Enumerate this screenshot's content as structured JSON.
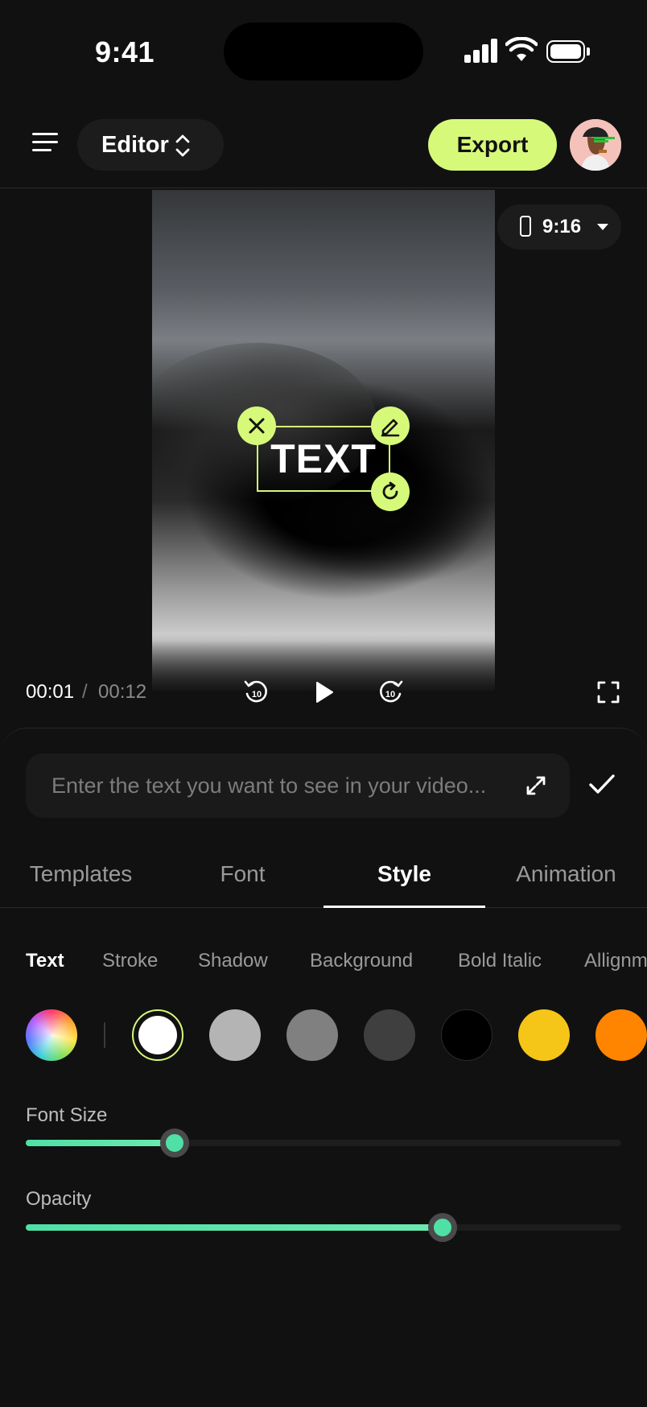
{
  "status_bar": {
    "time": "9:41"
  },
  "header": {
    "editor_label": "Editor",
    "export_label": "Export"
  },
  "preview": {
    "aspect_ratio": "9:16",
    "overlay_text": "TEXT"
  },
  "playback": {
    "current_time": "00:01",
    "separator": "/",
    "total_time": "00:12"
  },
  "text_input": {
    "placeholder": "Enter the text you want to see in your video..."
  },
  "tabs": [
    {
      "label": "Templates"
    },
    {
      "label": "Font"
    },
    {
      "label": "Style"
    },
    {
      "label": "Animation"
    }
  ],
  "active_tab": "Style",
  "sub_tabs": [
    {
      "label": "Text"
    },
    {
      "label": "Stroke"
    },
    {
      "label": "Shadow"
    },
    {
      "label": "Background"
    },
    {
      "label": "Bold Italic"
    },
    {
      "label": "Allignment"
    }
  ],
  "active_sub_tab": "Text",
  "colors": {
    "accent": "#D6F97A",
    "slider": "#4FE0A6",
    "swatches": [
      "#FFFFFF",
      "#B4B4B4",
      "#808080",
      "#3F3F3F",
      "#000000",
      "#F5C518",
      "#FF8500"
    ],
    "selected_swatch": "#FFFFFF"
  },
  "sliders": {
    "font_size": {
      "label": "Font Size",
      "value": 0.25
    },
    "opacity": {
      "label": "Opacity",
      "value": 0.7
    }
  }
}
